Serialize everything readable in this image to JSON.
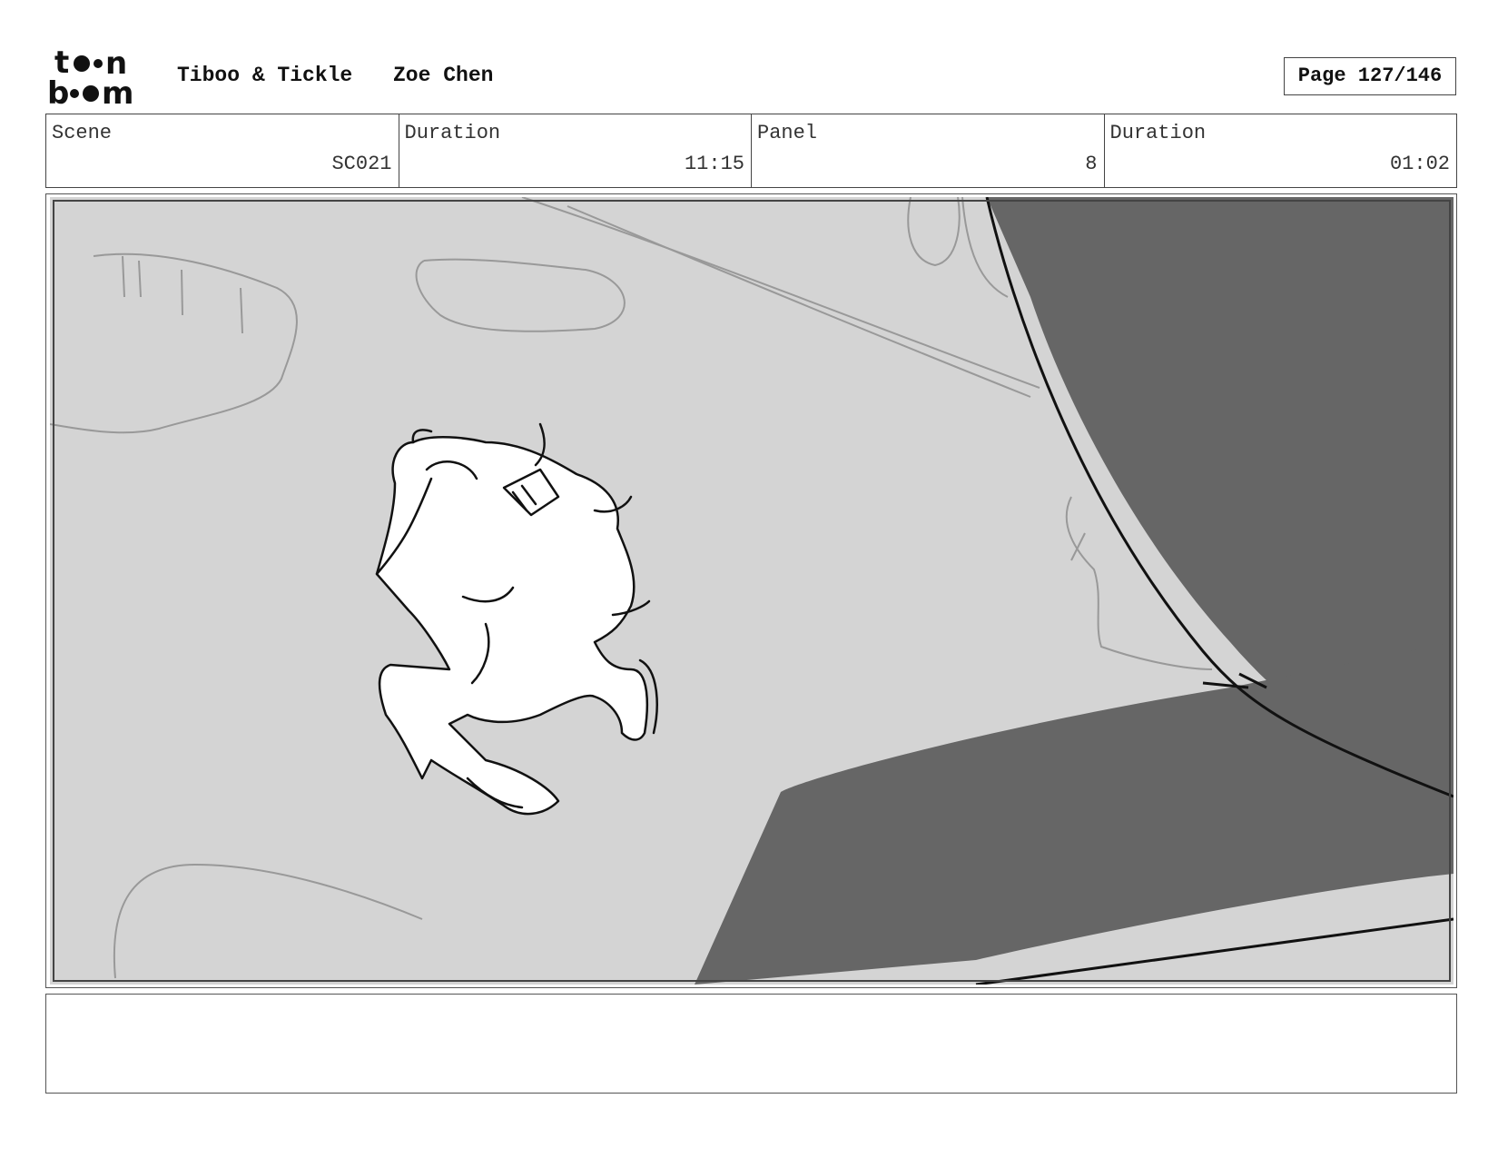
{
  "header": {
    "project_title": "Tiboo & Tickle",
    "artist": "Zoe Chen",
    "page_label": "Page 127/146",
    "logo_name": "toon-boom-logo"
  },
  "info": {
    "scene_label": "Scene",
    "scene_value": "SC021",
    "scene_duration_label": "Duration",
    "scene_duration_value": "11:15",
    "panel_label": "Panel",
    "panel_value": "8",
    "panel_duration_label": "Duration",
    "panel_duration_value": "01:02"
  },
  "panel": {
    "background_color": "#d4d4d4",
    "shadow_color": "#666666"
  },
  "notes": {
    "text": ""
  }
}
